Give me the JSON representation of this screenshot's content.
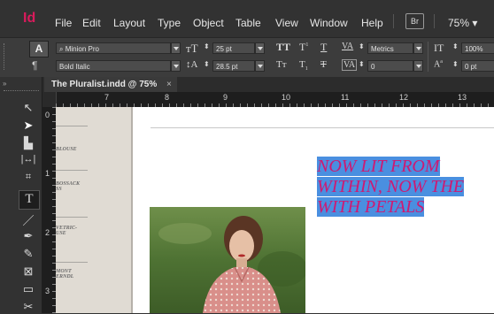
{
  "app": {
    "logo": "Id"
  },
  "menu": {
    "items": [
      "File",
      "Edit",
      "Layout",
      "Type",
      "Object",
      "Table",
      "View",
      "Window",
      "Help"
    ],
    "bridge": "Br",
    "zoom": "75% ▾"
  },
  "control": {
    "font_family": "Minion Pro",
    "font_style": "Bold Italic",
    "font_size": "25 pt",
    "leading": "28.5 pt",
    "kerning": "Metrics",
    "tracking": "0",
    "vscale": "100%",
    "baseline": "0 pt"
  },
  "document": {
    "tab_title": "The Pluralist.indd @ 75%",
    "close": "×"
  },
  "ruler": {
    "h_numbers": [
      "7",
      "8",
      "9",
      "10",
      "11",
      "12",
      "13"
    ],
    "v_numbers": [
      "0",
      "1",
      "2",
      "3"
    ]
  },
  "pasteboard": {
    "labels": [
      "BLOUSE",
      "BOSSACK\nSS",
      "VETRIC-\nUSE",
      "MONT\nERNDL"
    ]
  },
  "page": {
    "headline_lines": [
      "NOW LIT FROM",
      "WITHIN, NOW THE",
      "WITH PETALS"
    ]
  },
  "colors": {
    "accent": "#d91b5c",
    "headline": "#cd1a73",
    "selection": "#4a8fe0",
    "ui_bg": "#323232"
  }
}
